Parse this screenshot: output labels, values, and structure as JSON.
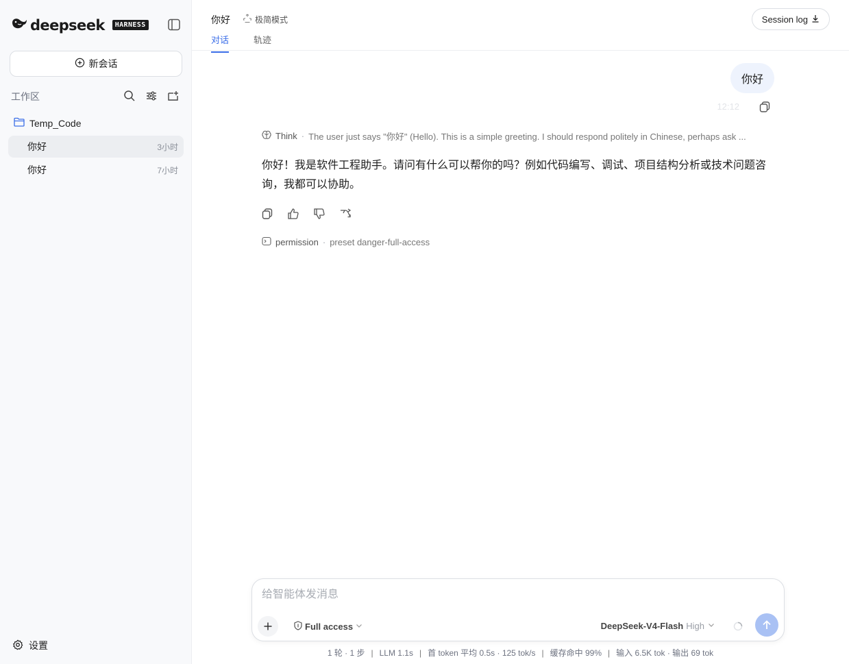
{
  "brand": {
    "name": "deepseek",
    "badge": "HARNESS"
  },
  "sidebar": {
    "new_chat_label": "新会话",
    "workspace_label": "工作区",
    "folder_name": "Temp_Code",
    "conversations": [
      {
        "title": "你好",
        "time": "3小时",
        "active": true
      },
      {
        "title": "你好",
        "time": "7小时",
        "active": false
      }
    ],
    "settings_label": "设置"
  },
  "header": {
    "title": "你好",
    "mode_label": "极简模式",
    "tabs": [
      {
        "label": "对话",
        "active": true
      },
      {
        "label": "轨迹",
        "active": false
      }
    ],
    "session_log_label": "Session log"
  },
  "chat": {
    "user_message": "你好",
    "user_time": "12:12",
    "think_label": "Think",
    "think_summary": "The user just says \"你好\" (Hello). This is a simple greeting. I should respond politely in Chinese, perhaps ask ...",
    "assistant_message": "你好！我是软件工程助手。请问有什么可以帮你的吗？例如代码编写、调试、项目结构分析或技术问题咨询，我都可以协助。",
    "permission_label": "permission",
    "permission_detail": "preset danger-full-access"
  },
  "composer": {
    "placeholder": "给智能体发消息",
    "value": "",
    "access_label": "Full access",
    "model_name": "DeepSeek-V4-Flash",
    "model_level": "High"
  },
  "stats": {
    "turns": "1 轮 · 1 步",
    "llm": "LLM 1.1s",
    "token_speed": "首 token 平均 0.5s · 125 tok/s",
    "cache": "缓存命中 99%",
    "io": "输入 6.5K tok · 输出 69 tok"
  },
  "colors": {
    "accent": "#3b6ee8",
    "send_button": "#a9c1f4",
    "user_bubble": "#eef3fd"
  }
}
